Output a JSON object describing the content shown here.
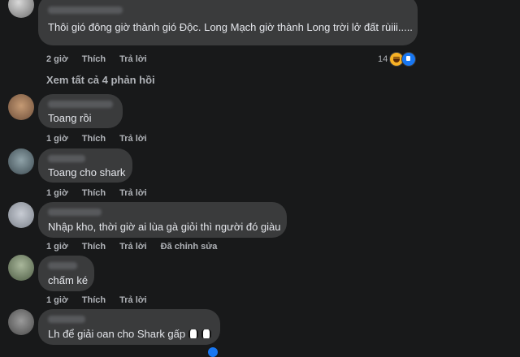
{
  "comments": [
    {
      "text": "Thôi gió đông giờ thành gió Độc. Long Mạch giờ thành Long trời lở đất rùiii.....",
      "time": "2 giờ",
      "like": "Thích",
      "reply": "Trả lời",
      "reaction_count": "14",
      "reaction_icons": [
        "haha-icon",
        "like-icon"
      ]
    },
    {
      "text": "Toang rồi",
      "time": "1 giờ",
      "like": "Thích",
      "reply": "Trả lời"
    },
    {
      "text": "Toang cho shark",
      "time": "1 giờ",
      "like": "Thích",
      "reply": "Trả lời"
    },
    {
      "text": "Nhập kho, thời giờ ai lùa gà giỏi thì người đó giàu",
      "time": "1 giờ",
      "like": "Thích",
      "reply": "Trả lời",
      "edited": "Đã chỉnh sửa"
    },
    {
      "text": "chấm ké",
      "time": "1 giờ",
      "like": "Thích",
      "reply": "Trả lời"
    },
    {
      "text": "Lh để giải oan cho Shark gấp",
      "emoji": "penguin-emoji"
    }
  ],
  "view_replies": "Xem tất cả 4 phản hồi",
  "colors": {
    "background": "#18191a",
    "bubble": "#3a3b3c",
    "text": "#e4e6eb",
    "secondary": "#b0b3b8"
  }
}
